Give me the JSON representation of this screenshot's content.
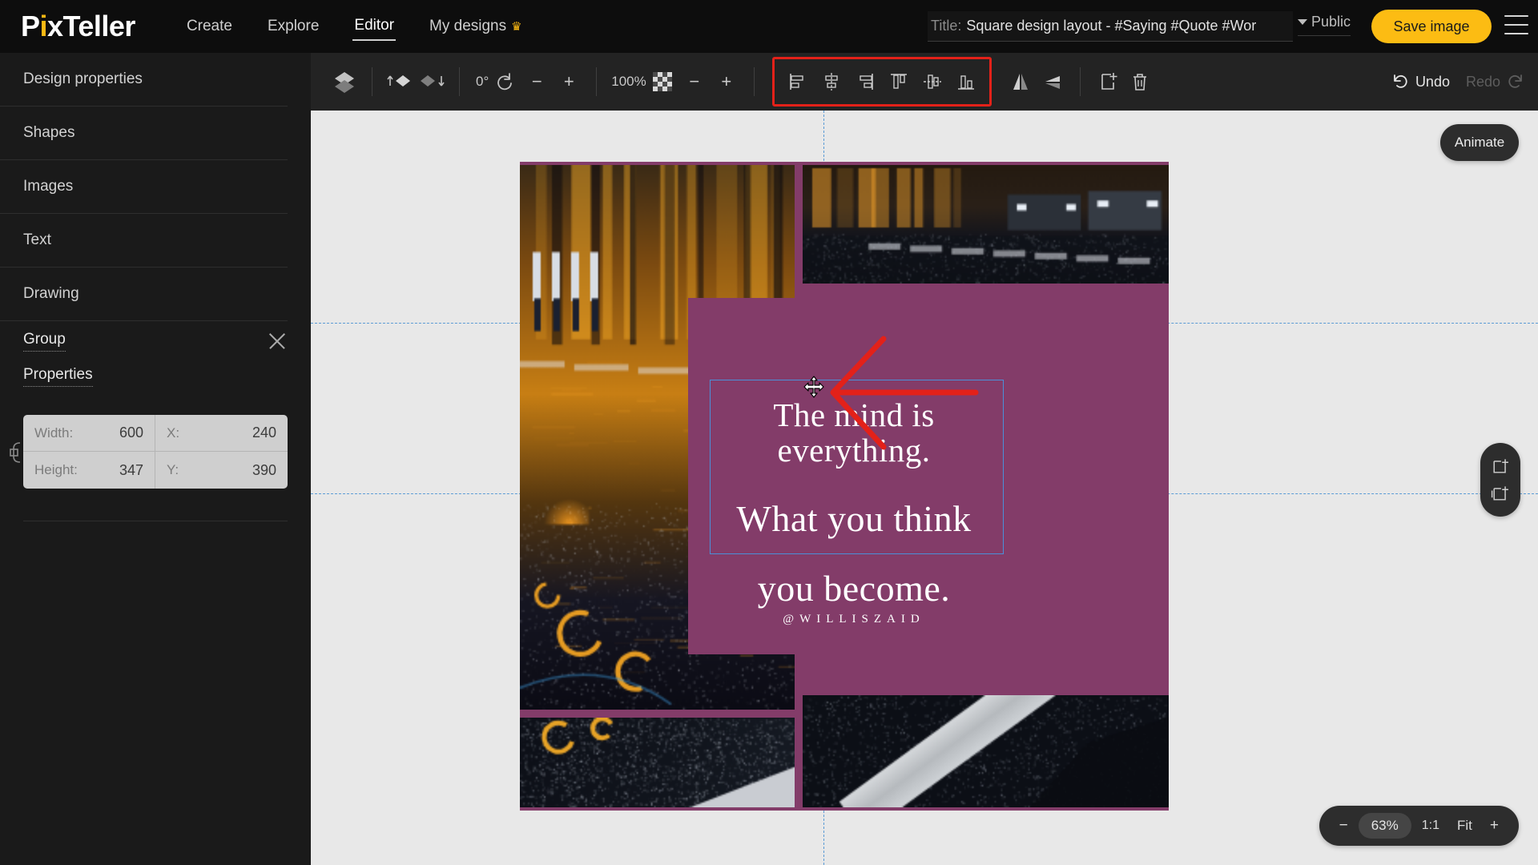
{
  "app": {
    "name": "PixTeller",
    "logo_main": "P",
    "logo_dot": "i",
    "logo_rest": "xTeller"
  },
  "nav": {
    "links": [
      {
        "label": "Create",
        "active": false,
        "crown": false
      },
      {
        "label": "Explore",
        "active": false,
        "crown": false
      },
      {
        "label": "Editor",
        "active": true,
        "crown": false
      },
      {
        "label": "My designs",
        "active": false,
        "crown": true
      }
    ]
  },
  "header": {
    "title_label": "Title:",
    "title_value": "Square design layout - #Saying #Quote #Wor",
    "visibility": "Public",
    "save_label": "Save image",
    "menu_icon": "hamburger-icon"
  },
  "sidebar": {
    "items": [
      {
        "label": "Design properties"
      },
      {
        "label": "Shapes"
      },
      {
        "label": "Images"
      },
      {
        "label": "Text"
      },
      {
        "label": "Drawing"
      }
    ],
    "group_label": "Group",
    "close_icon": "close-icon",
    "properties_label": "Properties",
    "properties": {
      "width_label": "Width:",
      "width_value": "600",
      "height_label": "Height:",
      "height_value": "347",
      "x_label": "X:",
      "x_value": "240",
      "y_label": "Y:",
      "y_value": "390",
      "link_icon": "link-chain-icon"
    }
  },
  "toolbar": {
    "layers_icon": "layers-icon",
    "bring_forward_icon": "bring-forward-icon",
    "send_backward_icon": "send-backward-icon",
    "rotation_value": "0°",
    "rotation_icon": "rotate-icon",
    "rotation_minus": "−",
    "rotation_plus": "+",
    "opacity_value": "100%",
    "opacity_icon": "transparency-checker-icon",
    "opacity_minus": "−",
    "opacity_plus": "+",
    "align_icons": [
      "align-left-icon",
      "align-center-horizontal-icon",
      "align-right-icon",
      "align-top-icon",
      "align-middle-vertical-icon",
      "align-bottom-icon"
    ],
    "flip_horizontal_icon": "flip-horizontal-icon",
    "flip_vertical_icon": "flip-vertical-icon",
    "duplicate_icon": "duplicate-icon",
    "delete_icon": "trash-icon",
    "undo_label": "Undo",
    "redo_label": "Redo",
    "undo_icon": "undo-arrow-icon",
    "redo_icon": "redo-arrow-icon"
  },
  "canvas": {
    "background_color": "#e8e8e8",
    "artboard_color": "#833c69",
    "animate_label": "Animate",
    "add_page_icon": "add-page-icon",
    "duplicate_page_icon": "duplicate-page-icon",
    "quote": {
      "line1": "The mind is",
      "line2": "everything.",
      "line3": "What you think",
      "line4": "you become.",
      "handle": "@WILLISZAID"
    },
    "selection_color": "#4a90d9",
    "annotation_color": "#e32119",
    "cursor_icon": "move-cursor-icon"
  },
  "zoom_bar": {
    "minus": "−",
    "percent": "63%",
    "one_to_one": "1:1",
    "fit": "Fit",
    "plus": "+"
  }
}
